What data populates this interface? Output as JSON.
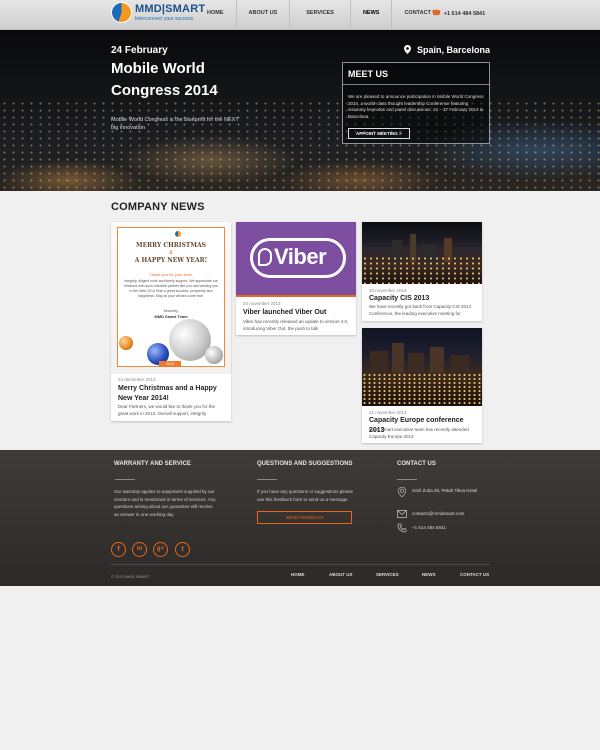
{
  "header": {
    "logo_text": "MMD|SMART",
    "logo_tagline": "Interconnect your success",
    "nav": [
      "HOME",
      "ABOUT US",
      "SERVICES",
      "NEWS",
      "CONTACT US"
    ],
    "active_nav": "NEWS",
    "phone": "+1 614 484 5841"
  },
  "hero": {
    "date": "24 February",
    "title": "Mobile World Congress 2014",
    "description": "Mobile World Congress is the blueprint for the NEXT big innovation",
    "location": "Spain, Barcelona",
    "meet_title": "MEET US",
    "meet_text": "We are pleased to announce participation in Mobile World Congress 2014, a world-class thought leadership Conference featuring visionary keynotes and panel discussions: 24 – 27 February 2014 in Barcelona.",
    "meet_button": "APPOINT MEETING >"
  },
  "news": {
    "heading": "COMPANY NEWS",
    "cards": [
      {
        "date": "24 december 2013",
        "title": "Merry Christmas and a Happy New Year 2014!",
        "text": "Dear Partners, we would like to thank you for the great work in 2013. Overall support, integrity",
        "image": {
          "line1": "MERRY CHRISTMAS",
          "line2": "&",
          "line3": "A HAPPY NEW YEAR!",
          "thanks": "Thank you for your trust.",
          "body": "Integrity, diligent work and timely support. We appreciate our relations with such valuable partner like you and wishing you in the New 2014 Year a great success, prosperity and happiness. May all your wishes come true.",
          "sign": "Sincerely,",
          "team": "MMD Smart Team",
          "badge": "2014"
        }
      },
      {
        "date": "20 november 2013",
        "title": "Viber launched Viber Out",
        "text": "Viber has recently released an update to version 4.0, introducing Viber Out, the push to talk",
        "image": {
          "word": "Viber"
        }
      },
      {
        "date": "20 november 2013",
        "title": "Capacity CIS 2013",
        "text": "We have recently got back from Capacity CIS 2013 Conference, the leading executive meeting for"
      },
      {
        "date": "21 november 2013",
        "title": "Capacity Europe conference 2013",
        "text": "MMD Smart executive team has recently attended Capacity Europe 2013"
      }
    ]
  },
  "footer": {
    "warranty_title": "WARRANTY AND SERVICE",
    "warranty_text": "Our warranty applies to equipment supplied by our vendors and is mentioned in terms of services. Any questions arising about our guarantee will receive an answer in one working day",
    "questions_title": "QUESTIONS AND SUGGESTIONS",
    "questions_text": "If you have any questions or suggestions please use this feedback form to send us a message",
    "feedback_button": "SEND FEEDBACK",
    "contact_title": "CONTACT US",
    "address": "Gmil Zuba 26, Petah Tikva Israel",
    "email": "contacts@mmdsmart.com",
    "phone": "+1 614 484 5841",
    "social": [
      "f",
      "in",
      "g+",
      "t"
    ],
    "copyright": "© 2013 MMD SMART",
    "nav": [
      "HOME",
      "ABOUT US",
      "SERVICES",
      "NEWS",
      "CONTACT US"
    ]
  },
  "colors": {
    "accent": "#e8661b",
    "brand_blue": "#1d6bb8",
    "viber_purple": "#7d4ea0"
  }
}
